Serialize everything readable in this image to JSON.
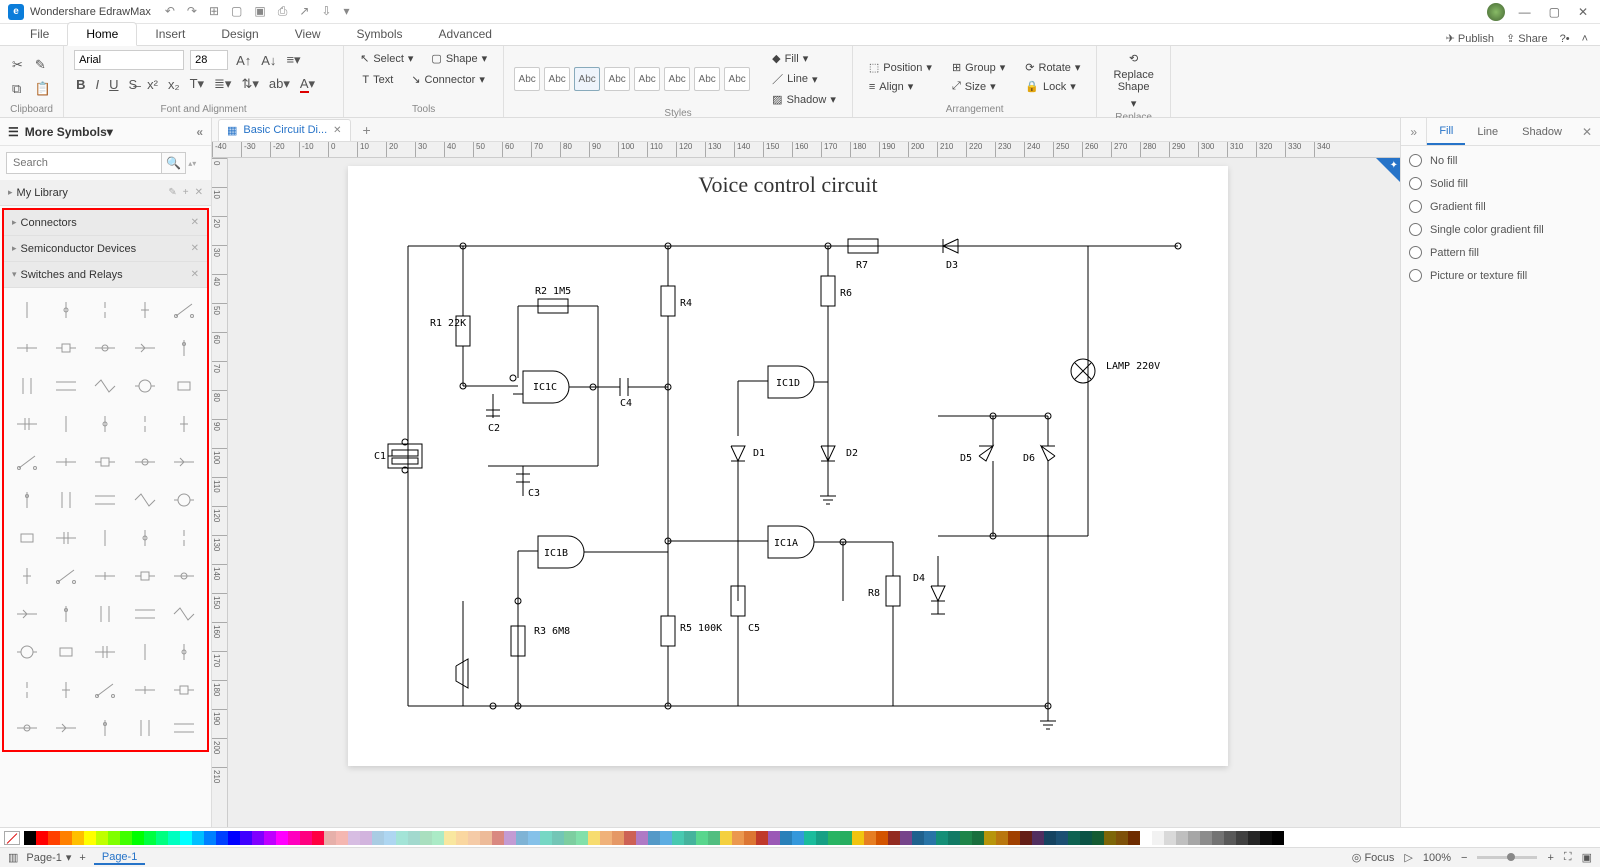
{
  "app_title": "Wondershare EdrawMax",
  "menu_tabs": [
    "File",
    "Home",
    "Insert",
    "Design",
    "View",
    "Symbols",
    "Advanced"
  ],
  "menu_active": "Home",
  "top_right": {
    "publish": "Publish",
    "share": "Share"
  },
  "ribbon": {
    "clipboard_label": "Clipboard",
    "font_label": "Font and Alignment",
    "font_name": "Arial",
    "font_size": "28",
    "tools_label": "Tools",
    "select": "Select",
    "text": "Text",
    "shape": "Shape",
    "connector": "Connector",
    "styles_label": "Styles",
    "abc": "Abc",
    "fill": "Fill",
    "line": "Line",
    "shadow": "Shadow",
    "arrange_label": "Arrangement",
    "position": "Position",
    "align": "Align",
    "group": "Group",
    "size": "Size",
    "rotate": "Rotate",
    "lock": "Lock",
    "replace_label": "Replace",
    "replace_shape": "Replace\nShape"
  },
  "left_panel": {
    "title": "More Symbols",
    "search_placeholder": "Search",
    "my_library": "My Library",
    "connectors": "Connectors",
    "semiconductor": "Semiconductor Devices",
    "switches": "Switches and Relays"
  },
  "doc_tab": {
    "name": "Basic Circuit Di..."
  },
  "canvas": {
    "title": "Voice control circuit",
    "labels": {
      "R1": "R1\n22K",
      "R2": "R2 1M5",
      "R3": "R3\n6M8",
      "R4": "R4",
      "R5": "R5\n100K",
      "R6": "R6",
      "R7": "R7",
      "R8": "R8",
      "C1": "C1",
      "C2": "C2",
      "C3": "C3",
      "C4": "C4",
      "C5": "C5",
      "D1": "D1",
      "D2": "D2",
      "D3": "D3",
      "D4": "D4",
      "D5": "D5",
      "D6": "D6",
      "IC1A": "IC1A",
      "IC1B": "IC1B",
      "IC1C": "IC1C",
      "IC1D": "IC1D",
      "LAMP": "LAMP\n220V"
    }
  },
  "right_panel": {
    "tabs": [
      "Fill",
      "Line",
      "Shadow"
    ],
    "active": "Fill",
    "options": [
      "No fill",
      "Solid fill",
      "Gradient fill",
      "Single color gradient fill",
      "Pattern fill",
      "Picture or texture fill"
    ]
  },
  "ruler_values_h": [
    "-40",
    "-30",
    "-20",
    "-10",
    "0",
    "10",
    "20",
    "30",
    "40",
    "50",
    "60",
    "70",
    "80",
    "90",
    "100",
    "110",
    "120",
    "130",
    "140",
    "150",
    "160",
    "170",
    "180",
    "190",
    "200",
    "210",
    "220",
    "230",
    "240",
    "250",
    "260",
    "270",
    "280",
    "290",
    "300",
    "310",
    "320",
    "330",
    "340"
  ],
  "ruler_values_v": [
    "0",
    "10",
    "20",
    "30",
    "40",
    "50",
    "60",
    "70",
    "80",
    "90",
    "100",
    "110",
    "120",
    "130",
    "140",
    "150",
    "160",
    "170",
    "180",
    "190",
    "200",
    "210"
  ],
  "status": {
    "page_sel": "Page-1",
    "page_tab": "Page-1",
    "focus": "Focus",
    "zoom": "100%"
  },
  "colors": [
    "#000000",
    "#ff0000",
    "#ff4000",
    "#ff8000",
    "#ffbf00",
    "#ffff00",
    "#bfff00",
    "#80ff00",
    "#40ff00",
    "#00ff00",
    "#00ff40",
    "#00ff80",
    "#00ffbf",
    "#00ffff",
    "#00bfff",
    "#0080ff",
    "#0040ff",
    "#0000ff",
    "#4000ff",
    "#8000ff",
    "#bf00ff",
    "#ff00ff",
    "#ff00bf",
    "#ff0080",
    "#ff0040",
    "#e6b0aa",
    "#f5b7b1",
    "#d7bde2",
    "#d2b4de",
    "#a9cce3",
    "#aed6f1",
    "#a3e4d7",
    "#a2d9ce",
    "#a9dfbf",
    "#abebc6",
    "#f9e79f",
    "#fad7a0",
    "#f5cba7",
    "#edbb99",
    "#d98880",
    "#c39bd3",
    "#7fb3d5",
    "#85c1e9",
    "#76d7c4",
    "#73c6b6",
    "#7dcea0",
    "#82e0aa",
    "#f7dc6f",
    "#f0b27a",
    "#e59866",
    "#cd6155",
    "#af7ac5",
    "#5499c7",
    "#5dade2",
    "#48c9b0",
    "#45b39d",
    "#58d68d",
    "#52be80",
    "#f4d03f",
    "#eb984e",
    "#dc7633",
    "#c0392b",
    "#9b59b6",
    "#2980b9",
    "#3498db",
    "#1abc9c",
    "#16a085",
    "#28b463",
    "#27ae60",
    "#f1c40f",
    "#e67e22",
    "#d35400",
    "#922b21",
    "#76448a",
    "#1f618d",
    "#2874a6",
    "#148f77",
    "#117a65",
    "#1e8449",
    "#196f3d",
    "#b7950b",
    "#b9770e",
    "#a04000",
    "#641e16",
    "#512e5f",
    "#154360",
    "#1b4f72",
    "#0e6251",
    "#0b5345",
    "#145a32",
    "#7d6608",
    "#7e5109",
    "#6e2c00",
    "#ffffff",
    "#f2f2f2",
    "#d9d9d9",
    "#bfbfbf",
    "#a6a6a6",
    "#8c8c8c",
    "#737373",
    "#595959",
    "#404040",
    "#262626",
    "#0d0d0d",
    "#000000"
  ]
}
